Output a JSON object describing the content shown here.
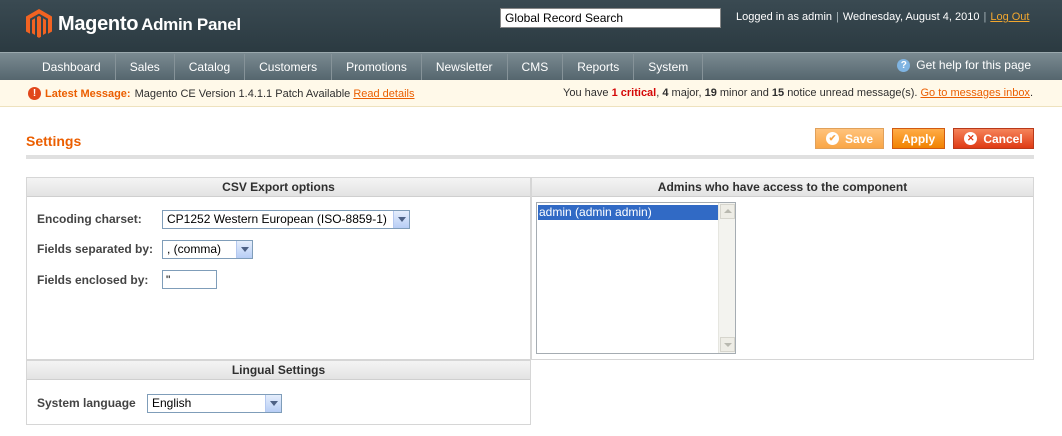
{
  "header": {
    "logo_brand": "Magento",
    "logo_sub": "Admin Panel",
    "search_value": "Global Record Search",
    "logged_in": "Logged in as admin",
    "date": "Wednesday, August 4, 2010",
    "logout": "Log Out"
  },
  "nav": {
    "items": [
      "Dashboard",
      "Sales",
      "Catalog",
      "Customers",
      "Promotions",
      "Newsletter",
      "CMS",
      "Reports",
      "System"
    ],
    "help": "Get help for this page"
  },
  "message": {
    "label": "Latest Message:",
    "text": "Magento CE Version 1.4.1.1 Patch Available",
    "link": "Read details",
    "summary_prefix": "You have",
    "critical": "1 critical",
    "major": "4",
    "major_label": "major,",
    "minor": "19",
    "minor_label": "minor and",
    "notice": "15",
    "notice_label": "notice unread message(s).",
    "inbox_link": "Go to messages inbox"
  },
  "page": {
    "title": "Settings",
    "buttons": {
      "save": "Save",
      "apply": "Apply",
      "cancel": "Cancel"
    }
  },
  "csv": {
    "heading": "CSV Export options",
    "encoding_label": "Encoding charset:",
    "encoding_value": "CP1252 Western European (ISO-8859-1)",
    "separator_label": "Fields separated by:",
    "separator_value": ", (comma)",
    "enclosed_label": "Fields enclosed by:",
    "enclosed_value": "\""
  },
  "admins": {
    "heading": "Admins who have access to the component",
    "options": [
      "admin (admin admin)"
    ]
  },
  "lingual": {
    "heading": "Lingual Settings",
    "language_label": "System language",
    "language_value": "English"
  },
  "colors": {
    "accent": "#eb5e00",
    "header_bg": "#2b3a41",
    "nav_bg": "#55666e",
    "selected": "#316ac5"
  }
}
